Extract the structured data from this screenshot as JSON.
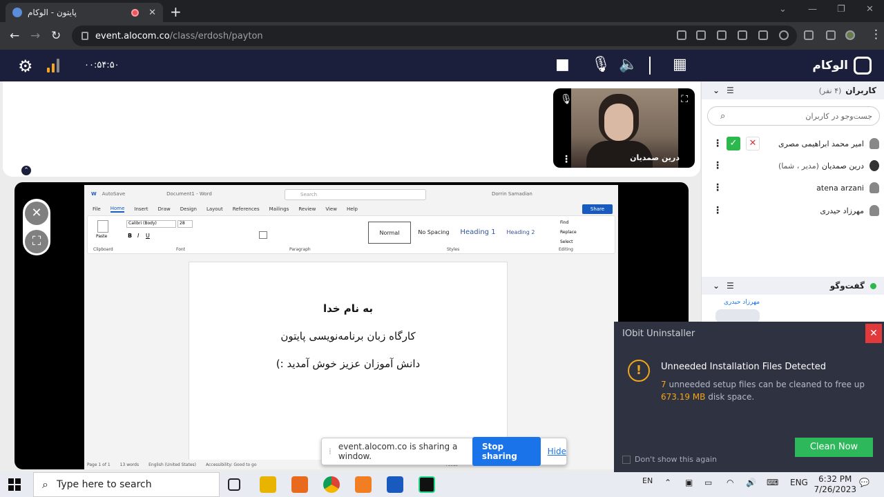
{
  "browser": {
    "tab_title": "پایتون - الوکام",
    "url_host": "event.alocom.co",
    "url_path": "/class/erdosh/payton"
  },
  "app": {
    "timer": "۰۰:۵۴:۵۰",
    "brand": "الوکام"
  },
  "webcam": {
    "name": "درین صمدیان"
  },
  "users_panel": {
    "title": "کاربران",
    "count": "(۴ نفر)",
    "search_placeholder": "جست‌وجو در کاربران",
    "users": [
      {
        "name": "امیر محمد ابراهیمی مصری",
        "role": ""
      },
      {
        "name": "درین صمدیان",
        "role": "(مدیر ، شما)"
      },
      {
        "name": "atena arzani",
        "role": ""
      },
      {
        "name": "مهرزاد حیدری",
        "role": ""
      }
    ]
  },
  "chat_panel": {
    "title": "گفت‌وگو",
    "last_sender": "مهرزاد حیدری"
  },
  "word": {
    "autosave": "AutoSave",
    "doc_title": "Document1 - Word",
    "search": "Search",
    "user": "Dorrin Samadian",
    "menu": [
      "File",
      "Home",
      "Insert",
      "Draw",
      "Design",
      "Layout",
      "References",
      "Mailings",
      "Review",
      "View",
      "Help"
    ],
    "share": "Share",
    "font_name": "Calibri (Body)",
    "font_size": "28",
    "groups": {
      "clipboard": "Clipboard",
      "font": "Font",
      "paragraph": "Paragraph",
      "styles": "Styles",
      "editing": "Editing"
    },
    "styles": [
      "Normal",
      "No Spacing",
      "Heading 1",
      "Heading 2"
    ],
    "editing": [
      "Find",
      "Replace",
      "Select"
    ],
    "paste": "Paste",
    "doc_lines": [
      "به نام خدا",
      "کارگاه زبان برنامه‌نویسی پایتون",
      "دانش آموزان عزیز خوش آمدید :)"
    ],
    "status": [
      "Page 1 of 1",
      "13 words",
      "English (United States)",
      "Accessibility: Good to go"
    ],
    "focus": "Focus"
  },
  "share_bar": {
    "message": "event.alocom.co is sharing a window.",
    "stop": "Stop sharing",
    "hide": "Hide"
  },
  "iobit": {
    "title": "IObit Uninstaller",
    "heading": "Unneeded Installation Files Detected",
    "count": "7",
    "desc_a": "unneeded setup files can be cleaned to free up",
    "size": "673.19 MB",
    "desc_b": "disk space.",
    "button": "Clean Now",
    "checkbox": "Don't show this again"
  },
  "taskbar": {
    "search": "Type here to search",
    "lang_small": "EN",
    "lang": "ENG",
    "time": "6:32 PM",
    "date": "7/26/2023"
  }
}
